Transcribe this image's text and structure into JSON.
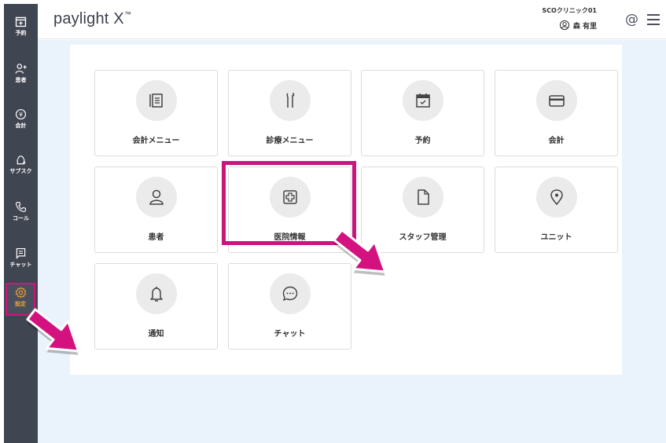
{
  "app": {
    "logo": "paylight X",
    "logo_mark": "™"
  },
  "header": {
    "clinic_name": "SCOクリニック01",
    "user_name": "森 有里",
    "at_symbol": "@"
  },
  "sidebar": {
    "items": [
      {
        "label": "予約",
        "icon": "calendar-plus-icon"
      },
      {
        "label": "患者",
        "icon": "person-add-icon"
      },
      {
        "label": "会計",
        "icon": "yen-icon"
      },
      {
        "label": "サブスク",
        "icon": "subscription-icon"
      },
      {
        "label": "コール",
        "icon": "phone-icon"
      },
      {
        "label": "チャット",
        "icon": "chat-icon"
      },
      {
        "label": "設定",
        "icon": "gear-icon"
      }
    ]
  },
  "tiles": [
    {
      "label": "会計メニュー",
      "icon": "list-doc-icon"
    },
    {
      "label": "診療メニュー",
      "icon": "dental-tools-icon"
    },
    {
      "label": "予約",
      "icon": "calendar-check-icon"
    },
    {
      "label": "会計",
      "icon": "credit-card-icon"
    },
    {
      "label": "患者",
      "icon": "person-icon"
    },
    {
      "label": "医院情報",
      "icon": "medical-cross-icon"
    },
    {
      "label": "スタッフ管理",
      "icon": "document-icon"
    },
    {
      "label": "ユニット",
      "icon": "location-pin-icon"
    },
    {
      "label": "通知",
      "icon": "bell-icon"
    },
    {
      "label": "チャット",
      "icon": "chat-bubble-icon"
    }
  ],
  "colors": {
    "sidebar_bg": "#404552",
    "highlight": "#c8167e",
    "pointer": "#d4127f",
    "active_label": "#f0a030",
    "main_bg": "#eaf3fb"
  }
}
